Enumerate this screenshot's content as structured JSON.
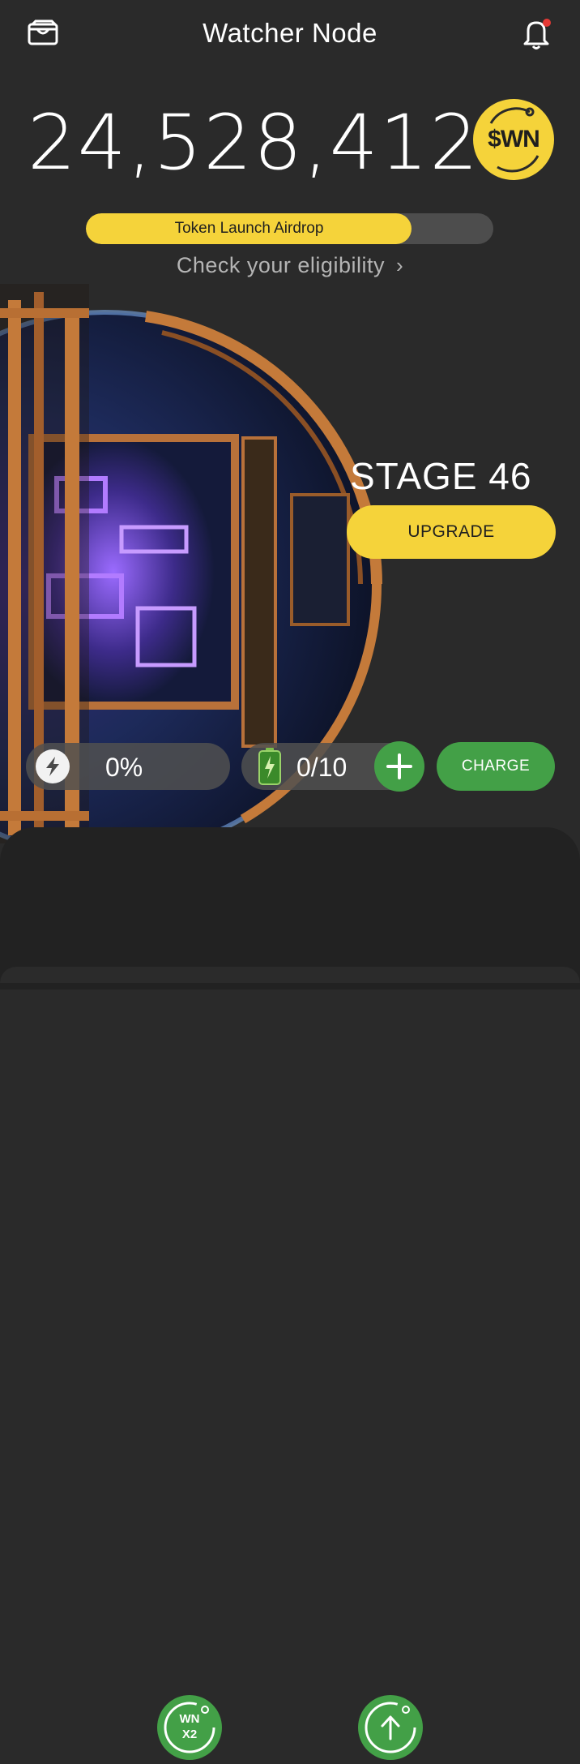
{
  "header": {
    "title": "Watcher Node"
  },
  "balance": {
    "amount": "24,528,412",
    "token_symbol": "$WN"
  },
  "airdrop": {
    "label": "Token Launch Airdrop",
    "progress_fraction": 0.8,
    "link_text": "Check your eligibility"
  },
  "stage": {
    "label": "STAGE 46",
    "upgrade_label": "UPGRADE"
  },
  "energy": {
    "value": "0%"
  },
  "battery": {
    "value": "0/10"
  },
  "charge": {
    "label": "CHARGE"
  },
  "bottom_nav": {
    "multiplier_line1": "WN",
    "multiplier_line2": "X2"
  },
  "colors": {
    "background": "#2a2a2a",
    "accent_yellow": "#f5d33a",
    "accent_green": "#43a047",
    "notification_dot": "#e53935"
  },
  "icons": [
    "wallet-icon",
    "bell-icon",
    "chevron-right-icon",
    "lightning-icon",
    "battery-icon",
    "plus-icon",
    "arrow-up-icon"
  ]
}
